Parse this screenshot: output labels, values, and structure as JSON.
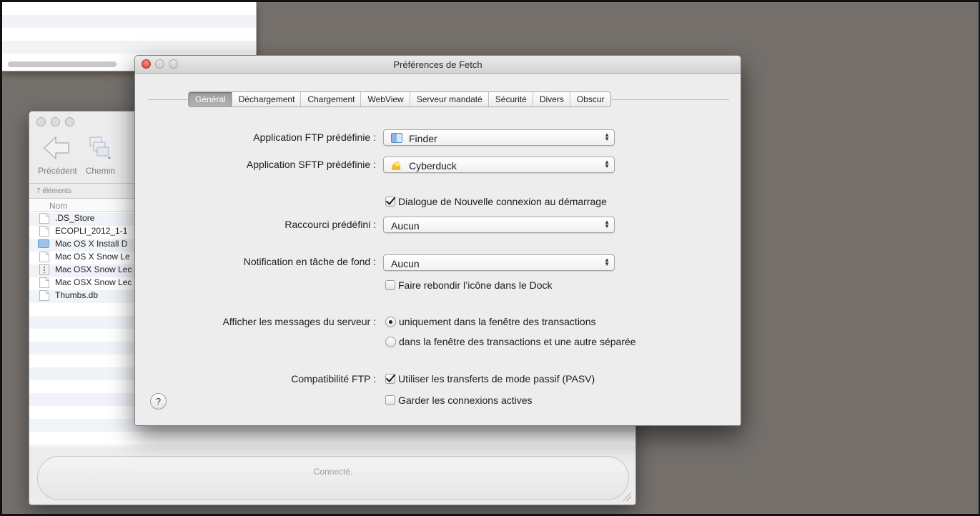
{
  "browser": {
    "toolbar": {
      "back_label": "Précédent",
      "path_label": "Chemin"
    },
    "item_count": "7 éléments",
    "column_name": "Nom",
    "files": [
      {
        "name": ".DS_Store",
        "kind": "document"
      },
      {
        "name": "ECOPLI_2012_1-1",
        "kind": "document"
      },
      {
        "name": "Mac OS X Install D",
        "kind": "folder"
      },
      {
        "name": "Mac OS X Snow Le",
        "kind": "document"
      },
      {
        "name": "Mac OSX Snow Lec",
        "kind": "archive"
      },
      {
        "name": "Mac OSX Snow Lec",
        "kind": "document"
      },
      {
        "name": "Thumbs.db",
        "kind": "document"
      }
    ],
    "status": "Connecté."
  },
  "prefs": {
    "title": "Préférences de Fetch",
    "tabs": [
      "Général",
      "Déchargement",
      "Chargement",
      "WebView",
      "Serveur mandaté",
      "Sécurité",
      "Divers",
      "Obscur"
    ],
    "active_tab": "Général",
    "ftp_app": {
      "label": "Application FTP prédéfinie :",
      "value": "Finder",
      "icon": "finder-icon"
    },
    "sftp_app": {
      "label": "Application SFTP prédéfinie :",
      "value": "Cyberduck",
      "icon": "cyberduck-icon"
    },
    "new_connection_dialog": {
      "label": "Dialogue de Nouvelle connexion au démarrage",
      "checked": true
    },
    "shortcut": {
      "label": "Raccourci prédéfini :",
      "value": "Aucun"
    },
    "notification": {
      "label": "Notification en tâche de fond :",
      "value": "Aucun"
    },
    "bounce_dock": {
      "label": "Faire rebondir l’icône dans le Dock",
      "checked": false
    },
    "server_messages": {
      "label": "Afficher les messages du serveur :",
      "options": [
        {
          "label": "uniquement dans la fenêtre des transactions",
          "selected": true
        },
        {
          "label": "dans la fenêtre des transactions et une autre séparée",
          "selected": false
        }
      ]
    },
    "ftp_compat": {
      "label": "Compatibilité FTP :",
      "passive": {
        "label": "Utiliser les transferts de mode passif (PASV)",
        "checked": true
      },
      "keepalive": {
        "label": "Garder les connexions actives",
        "checked": false
      }
    },
    "help_label": "?"
  }
}
